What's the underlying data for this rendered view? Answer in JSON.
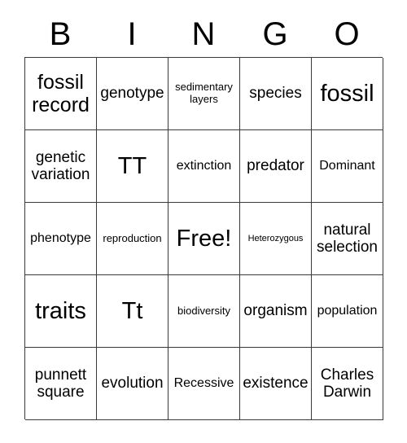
{
  "card": {
    "header_letters": [
      "B",
      "I",
      "N",
      "G",
      "O"
    ],
    "rows": [
      [
        {
          "text": "fossil record",
          "size": "lg"
        },
        {
          "text": "genotype",
          "size": "md"
        },
        {
          "text": "sedimentary layers",
          "size": "xs"
        },
        {
          "text": "species",
          "size": "md"
        },
        {
          "text": "fossil",
          "size": "xl"
        }
      ],
      [
        {
          "text": "genetic variation",
          "size": "md"
        },
        {
          "text": "TT",
          "size": "xl"
        },
        {
          "text": "extinction",
          "size": "sm"
        },
        {
          "text": "predator",
          "size": "md"
        },
        {
          "text": "Dominant",
          "size": "sm"
        }
      ],
      [
        {
          "text": "phenotype",
          "size": "sm"
        },
        {
          "text": "reproduction",
          "size": "xs"
        },
        {
          "text": "Free!",
          "size": "xl"
        },
        {
          "text": "Heterozygous",
          "size": "xxs"
        },
        {
          "text": "natural selection",
          "size": "md"
        }
      ],
      [
        {
          "text": "traits",
          "size": "xl"
        },
        {
          "text": "Tt",
          "size": "xl"
        },
        {
          "text": "biodiversity",
          "size": "xs"
        },
        {
          "text": "organism",
          "size": "md"
        },
        {
          "text": "population",
          "size": "sm"
        }
      ],
      [
        {
          "text": "punnett square",
          "size": "md"
        },
        {
          "text": "evolution",
          "size": "md"
        },
        {
          "text": "Recessive",
          "size": "sm"
        },
        {
          "text": "existence",
          "size": "md"
        },
        {
          "text": "Charles Darwin",
          "size": "md"
        }
      ]
    ],
    "colors": {
      "background": "#ffffff",
      "text": "#000000",
      "border": "#3a3a3a"
    }
  }
}
